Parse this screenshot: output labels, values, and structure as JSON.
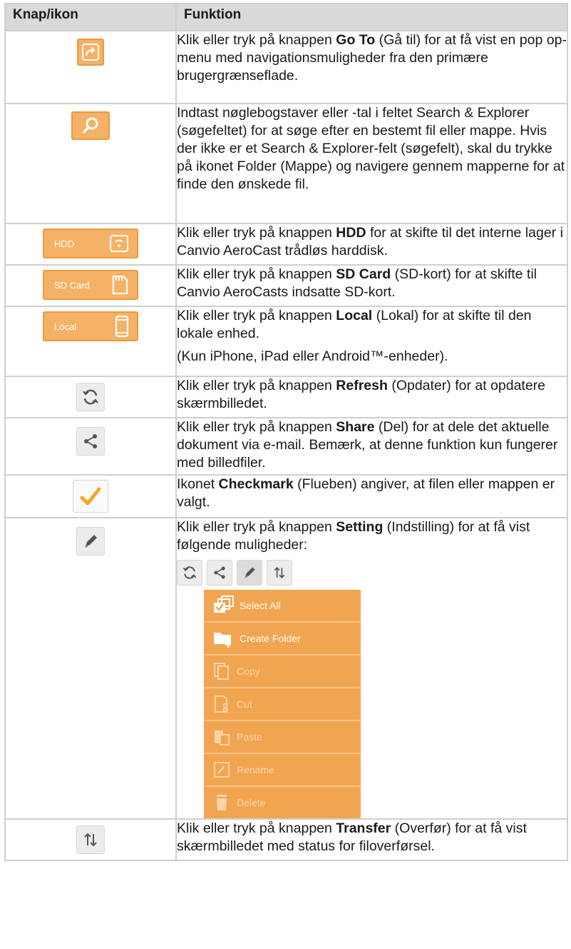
{
  "headers": {
    "col1": "Knap/ikon",
    "col2": "Funktion"
  },
  "rows": {
    "goto": {
      "pre": "Klik eller tryk på knappen ",
      "bold": "Go To",
      "post": " (Gå til) for at få vist en pop op-menu med navigationsmuligheder fra den primære brugergrænseflade."
    },
    "search": {
      "text": "Indtast nøglebogstaver eller -tal i feltet Search & Explorer (søgefeltet) for at søge efter en bestemt fil eller mappe. Hvis der ikke er et Search & Explorer-felt (søgefelt), skal du trykke på ikonet Folder (Mappe) og navigere gennem mapperne for at finde den ønskede fil."
    },
    "hdd": {
      "label": "HDD",
      "pre": "Klik eller tryk på knappen ",
      "bold": "HDD",
      "post": " for at skifte til det interne lager i Canvio AeroCast trådløs harddisk."
    },
    "sd": {
      "label": "SD Card",
      "pre": "Klik eller tryk på knappen ",
      "bold": "SD Card",
      "post": " (SD-kort) for at skifte til Canvio AeroCasts indsatte SD-kort."
    },
    "local": {
      "label": "Local",
      "pre": "Klik eller tryk på knappen ",
      "bold": "Local",
      "post": " (Lokal) for at skifte til den lokale enhed.",
      "note": "(Kun iPhone, iPad eller Android™-enheder)."
    },
    "refresh": {
      "pre": "Klik eller tryk på knappen ",
      "bold": "Refresh",
      "post": " (Opdater) for at opdatere skærmbilledet."
    },
    "share": {
      "pre": "Klik eller tryk på knappen ",
      "bold": "Share",
      "post": " (Del) for at dele det aktuelle dokument via e-mail. Bemærk, at denne funktion kun fungerer med billedfiler."
    },
    "checkmark": {
      "pre": "Ikonet ",
      "bold": "Checkmark",
      "post": " (Flueben) angiver, at filen eller mappen er valgt."
    },
    "setting": {
      "pre": "Klik eller tryk på knappen ",
      "bold": "Setting",
      "post": " (Indstilling) for at få vist følgende muligheder:"
    },
    "transfer": {
      "pre": "Klik eller tryk på knappen ",
      "bold": "Transfer",
      "post": " (Overfør) for at få vist skærmbilledet med status for filoverførsel."
    }
  },
  "menu": {
    "items": [
      {
        "label": "Select All",
        "enabled": true,
        "icon": "select-all-icon"
      },
      {
        "label": "Create Folder",
        "enabled": true,
        "icon": "create-folder-icon"
      },
      {
        "label": "Copy",
        "enabled": false,
        "icon": "copy-icon"
      },
      {
        "label": "Cut",
        "enabled": false,
        "icon": "cut-icon"
      },
      {
        "label": "Paste",
        "enabled": false,
        "icon": "paste-icon"
      },
      {
        "label": "Rename",
        "enabled": false,
        "icon": "rename-icon"
      },
      {
        "label": "Delete",
        "enabled": false,
        "icon": "delete-icon"
      }
    ]
  },
  "colors": {
    "accent": "#f5b165",
    "accent_border": "#e89a40",
    "header_bg": "#d9d9d9",
    "menu_bg": "#f2a550",
    "checkmark": "#f5a623"
  }
}
